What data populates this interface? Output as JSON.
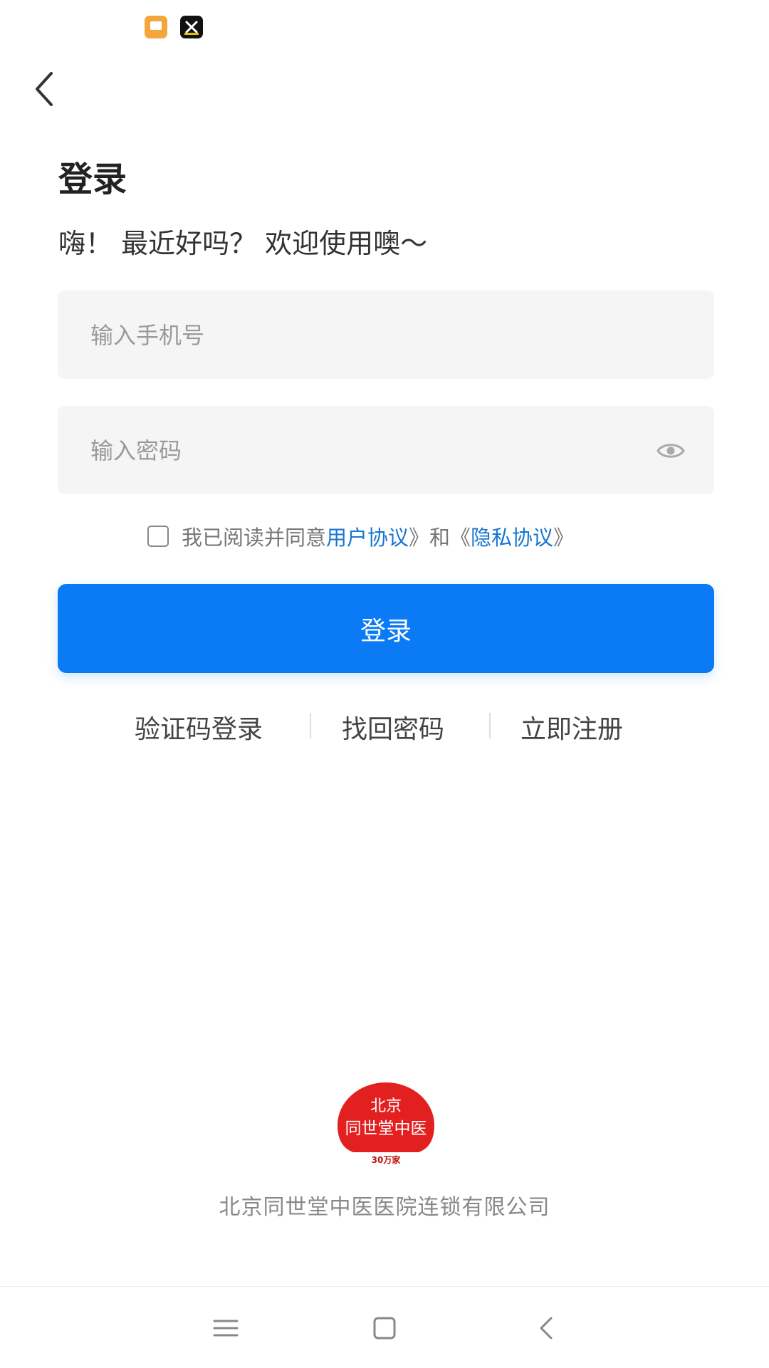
{
  "status_bar": {
    "icons": [
      "message-app-icon",
      "capcut-app-icon"
    ]
  },
  "header": {
    "back_icon": "chevron-left-icon"
  },
  "title": "登录",
  "subtitle": "嗨！ 最近好吗？ 欢迎使用噢〜",
  "phone_field": {
    "placeholder": "输入手机号",
    "value": ""
  },
  "password_field": {
    "placeholder": "输入密码",
    "value": "",
    "toggle_icon": "eye-icon"
  },
  "agreement": {
    "checked": false,
    "prefix": "我已阅读并同意",
    "user_agreement": "用户协议",
    "middle": "》和《",
    "privacy_agreement": "隐私协议",
    "suffix": "》"
  },
  "login_button": "登录",
  "alt_links": {
    "sms_login": "验证码登录",
    "forgot_password": "找回密码",
    "register": "立即注册"
  },
  "footer": {
    "logo": {
      "line1": "北京",
      "line2": "同世堂中医",
      "line3": "30万家"
    },
    "company": "北京同世堂中医医院连锁有限公司"
  },
  "colors": {
    "primary": "#0a7af5",
    "link": "#1976d2",
    "field_bg": "#f5f5f5",
    "logo_red": "#e32020"
  },
  "nav_bar": {
    "icons": [
      "menu-icon",
      "home-icon",
      "back-icon"
    ]
  }
}
